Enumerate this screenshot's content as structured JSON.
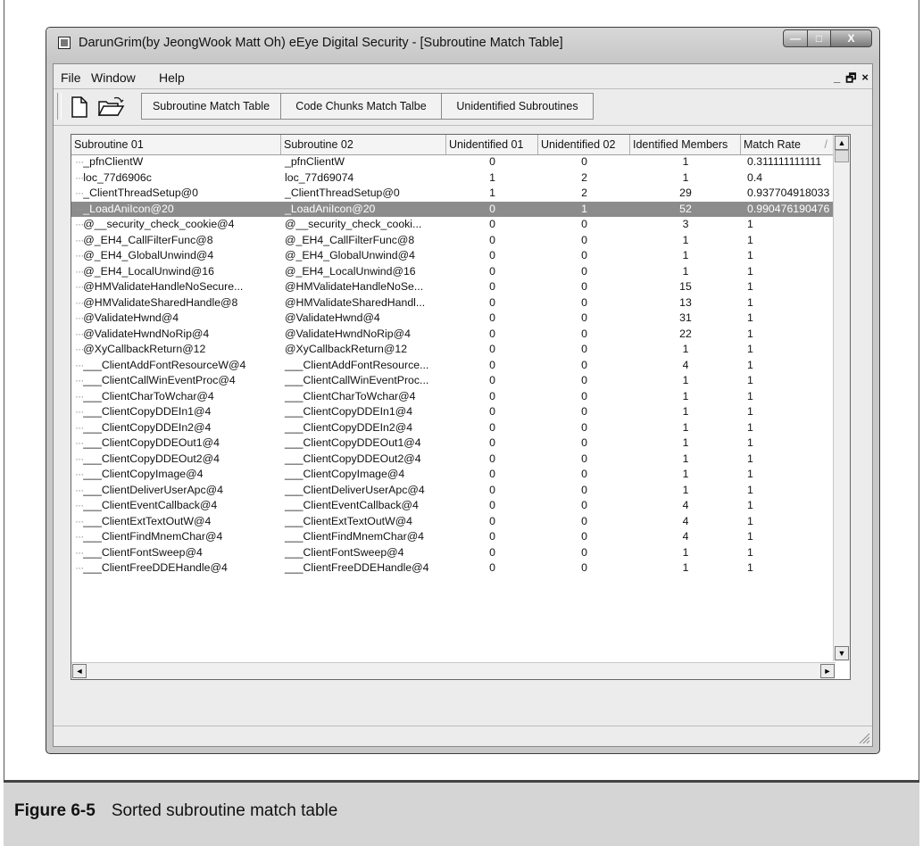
{
  "window": {
    "title": "DarunGrim(by JeongWook Matt Oh) eEye Digital Security - [Subroutine Match Table]",
    "min_glyph": "—",
    "max_glyph": "□",
    "close_glyph": "X"
  },
  "menu": {
    "file": "File",
    "window": "Window",
    "help": "Help",
    "mdi_min": "_",
    "mdi_restore": "🗗",
    "mdi_close": "×"
  },
  "toolbar": {
    "btn_subroutine_match": "Subroutine Match Table",
    "btn_code_chunks": "Code Chunks Match Talbe",
    "btn_unidentified": "Unidentified Subroutines"
  },
  "table": {
    "headers": [
      "Subroutine 01",
      "Subroutine 02",
      "Unidentified 01",
      "Unidentified 02",
      "Identified Members",
      "Match Rate"
    ],
    "sort_glyph": "/",
    "rows": [
      {
        "tree": "···",
        "s1": "_pfnClientW",
        "s2": "_pfnClientW",
        "u1": "0",
        "u2": "0",
        "im": "1",
        "mr": "0.311111111111"
      },
      {
        "tree": "···",
        "s1": "loc_77d6906c",
        "s2": "loc_77d69074",
        "u1": "1",
        "u2": "2",
        "im": "1",
        "mr": "0.4"
      },
      {
        "tree": "···",
        "s1": "_ClientThreadSetup@0",
        "s2": "_ClientThreadSetup@0",
        "u1": "1",
        "u2": "2",
        "im": "29",
        "mr": "0.937704918033"
      },
      {
        "tree": "···",
        "s1": "_LoadAniIcon@20",
        "s2": "_LoadAniIcon@20",
        "u1": "0",
        "u2": "1",
        "im": "52",
        "mr": "0.990476190476",
        "selected": true
      },
      {
        "tree": "···",
        "s1": "@__security_check_cookie@4",
        "s2": "@__security_check_cooki...",
        "u1": "0",
        "u2": "0",
        "im": "3",
        "mr": "1"
      },
      {
        "tree": "···",
        "s1": "@_EH4_CallFilterFunc@8",
        "s2": "@_EH4_CallFilterFunc@8",
        "u1": "0",
        "u2": "0",
        "im": "1",
        "mr": "1"
      },
      {
        "tree": "···",
        "s1": "@_EH4_GlobalUnwind@4",
        "s2": "@_EH4_GlobalUnwind@4",
        "u1": "0",
        "u2": "0",
        "im": "1",
        "mr": "1"
      },
      {
        "tree": "···",
        "s1": "@_EH4_LocalUnwind@16",
        "s2": "@_EH4_LocalUnwind@16",
        "u1": "0",
        "u2": "0",
        "im": "1",
        "mr": "1"
      },
      {
        "tree": "···",
        "s1": "@HMValidateHandleNoSecure...",
        "s2": "@HMValidateHandleNoSe...",
        "u1": "0",
        "u2": "0",
        "im": "15",
        "mr": "1"
      },
      {
        "tree": "···",
        "s1": "@HMValidateSharedHandle@8",
        "s2": "@HMValidateSharedHandl...",
        "u1": "0",
        "u2": "0",
        "im": "13",
        "mr": "1"
      },
      {
        "tree": "···",
        "s1": "@ValidateHwnd@4",
        "s2": "@ValidateHwnd@4",
        "u1": "0",
        "u2": "0",
        "im": "31",
        "mr": "1"
      },
      {
        "tree": "···",
        "s1": "@ValidateHwndNoRip@4",
        "s2": "@ValidateHwndNoRip@4",
        "u1": "0",
        "u2": "0",
        "im": "22",
        "mr": "1"
      },
      {
        "tree": "···",
        "s1": "@XyCallbackReturn@12",
        "s2": "@XyCallbackReturn@12",
        "u1": "0",
        "u2": "0",
        "im": "1",
        "mr": "1"
      },
      {
        "tree": "···",
        "s1": "___ClientAddFontResourceW@4",
        "s2": "___ClientAddFontResource...",
        "u1": "0",
        "u2": "0",
        "im": "4",
        "mr": "1"
      },
      {
        "tree": "···",
        "s1": "___ClientCallWinEventProc@4",
        "s2": "___ClientCallWinEventProc...",
        "u1": "0",
        "u2": "0",
        "im": "1",
        "mr": "1"
      },
      {
        "tree": "···",
        "s1": "___ClientCharToWchar@4",
        "s2": "___ClientCharToWchar@4",
        "u1": "0",
        "u2": "0",
        "im": "1",
        "mr": "1"
      },
      {
        "tree": "···",
        "s1": "___ClientCopyDDEIn1@4",
        "s2": "___ClientCopyDDEIn1@4",
        "u1": "0",
        "u2": "0",
        "im": "1",
        "mr": "1"
      },
      {
        "tree": "···",
        "s1": "___ClientCopyDDEIn2@4",
        "s2": "___ClientCopyDDEIn2@4",
        "u1": "0",
        "u2": "0",
        "im": "1",
        "mr": "1"
      },
      {
        "tree": "···",
        "s1": "___ClientCopyDDEOut1@4",
        "s2": "___ClientCopyDDEOut1@4",
        "u1": "0",
        "u2": "0",
        "im": "1",
        "mr": "1"
      },
      {
        "tree": "···",
        "s1": "___ClientCopyDDEOut2@4",
        "s2": "___ClientCopyDDEOut2@4",
        "u1": "0",
        "u2": "0",
        "im": "1",
        "mr": "1"
      },
      {
        "tree": "···",
        "s1": "___ClientCopyImage@4",
        "s2": "___ClientCopyImage@4",
        "u1": "0",
        "u2": "0",
        "im": "1",
        "mr": "1"
      },
      {
        "tree": "···",
        "s1": "___ClientDeliverUserApc@4",
        "s2": "___ClientDeliverUserApc@4",
        "u1": "0",
        "u2": "0",
        "im": "1",
        "mr": "1"
      },
      {
        "tree": "···",
        "s1": "___ClientEventCallback@4",
        "s2": "___ClientEventCallback@4",
        "u1": "0",
        "u2": "0",
        "im": "4",
        "mr": "1"
      },
      {
        "tree": "···",
        "s1": "___ClientExtTextOutW@4",
        "s2": "___ClientExtTextOutW@4",
        "u1": "0",
        "u2": "0",
        "im": "4",
        "mr": "1"
      },
      {
        "tree": "···",
        "s1": "___ClientFindMnemChar@4",
        "s2": "___ClientFindMnemChar@4",
        "u1": "0",
        "u2": "0",
        "im": "4",
        "mr": "1"
      },
      {
        "tree": "···",
        "s1": "___ClientFontSweep@4",
        "s2": "___ClientFontSweep@4",
        "u1": "0",
        "u2": "0",
        "im": "1",
        "mr": "1"
      },
      {
        "tree": "···",
        "s1": "___ClientFreeDDEHandle@4",
        "s2": "___ClientFreeDDEHandle@4",
        "u1": "0",
        "u2": "0",
        "im": "1",
        "mr": "1"
      }
    ]
  },
  "scroll": {
    "up": "▲",
    "down": "▼",
    "left": "◄",
    "right": "►"
  },
  "caption": {
    "figure": "Figure 6-5",
    "text": "Sorted subroutine match table"
  }
}
